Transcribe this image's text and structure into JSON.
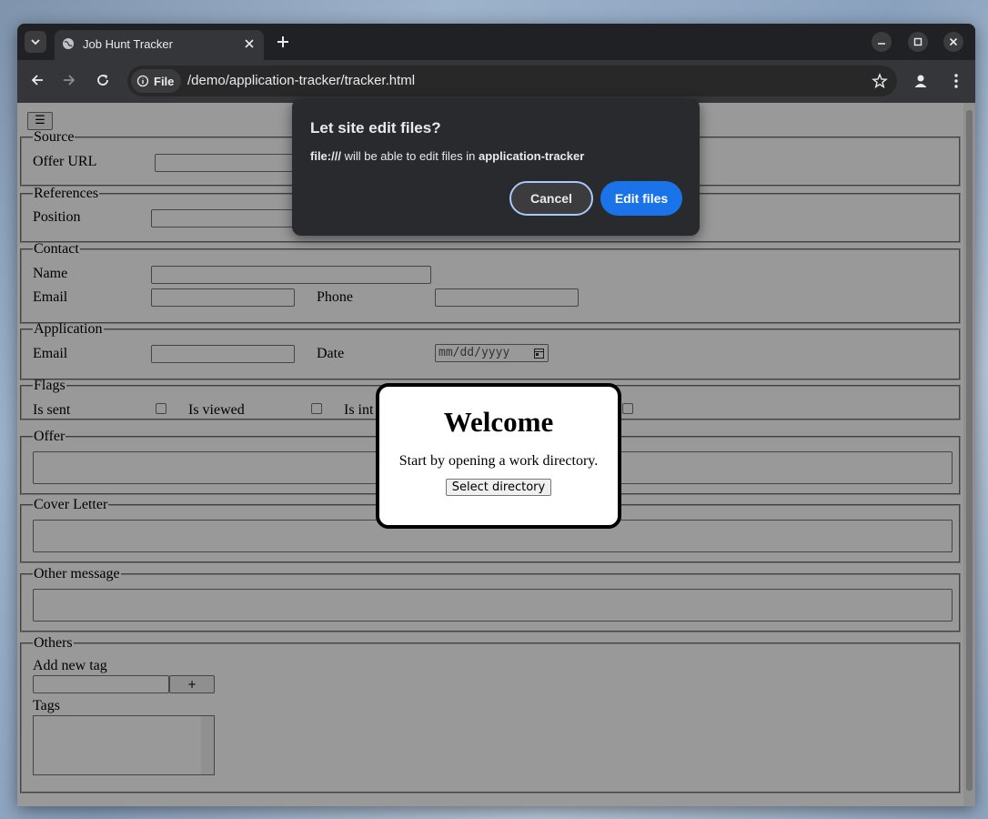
{
  "browser": {
    "tab_title": "Job Hunt Tracker",
    "address_chip": "File",
    "url": "/demo/application-tracker/tracker.html"
  },
  "page": {
    "menu_icon": "☰",
    "sections": {
      "source": {
        "legend": "Source",
        "offer_url_label": "Offer URL"
      },
      "references": {
        "legend": "References",
        "position_label": "Position"
      },
      "contact": {
        "legend": "Contact",
        "name_label": "Name",
        "email_label": "Email",
        "phone_label": "Phone"
      },
      "application": {
        "legend": "Application",
        "email_label": "Email",
        "date_label": "Date",
        "date_placeholder": "mm/dd/yyyy"
      },
      "flags": {
        "legend": "Flags",
        "is_sent_label": "Is sent",
        "is_viewed_label": "Is viewed",
        "third_label_partial": "Is int"
      },
      "offer": {
        "legend": "Offer"
      },
      "cover_letter": {
        "legend": "Cover Letter"
      },
      "other_message": {
        "legend": "Other message"
      },
      "others": {
        "legend": "Others",
        "add_tag_label": "Add new tag",
        "add_tag_button": "+",
        "tags_label": "Tags"
      }
    }
  },
  "welcome_dialog": {
    "title": "Welcome",
    "message": "Start by opening a work directory.",
    "button": "Select directory"
  },
  "permission_prompt": {
    "title": "Let site edit files?",
    "origin": "file:///",
    "message_middle": " will be able to edit files in ",
    "folder": "application-tracker",
    "cancel": "Cancel",
    "confirm": "Edit files"
  }
}
